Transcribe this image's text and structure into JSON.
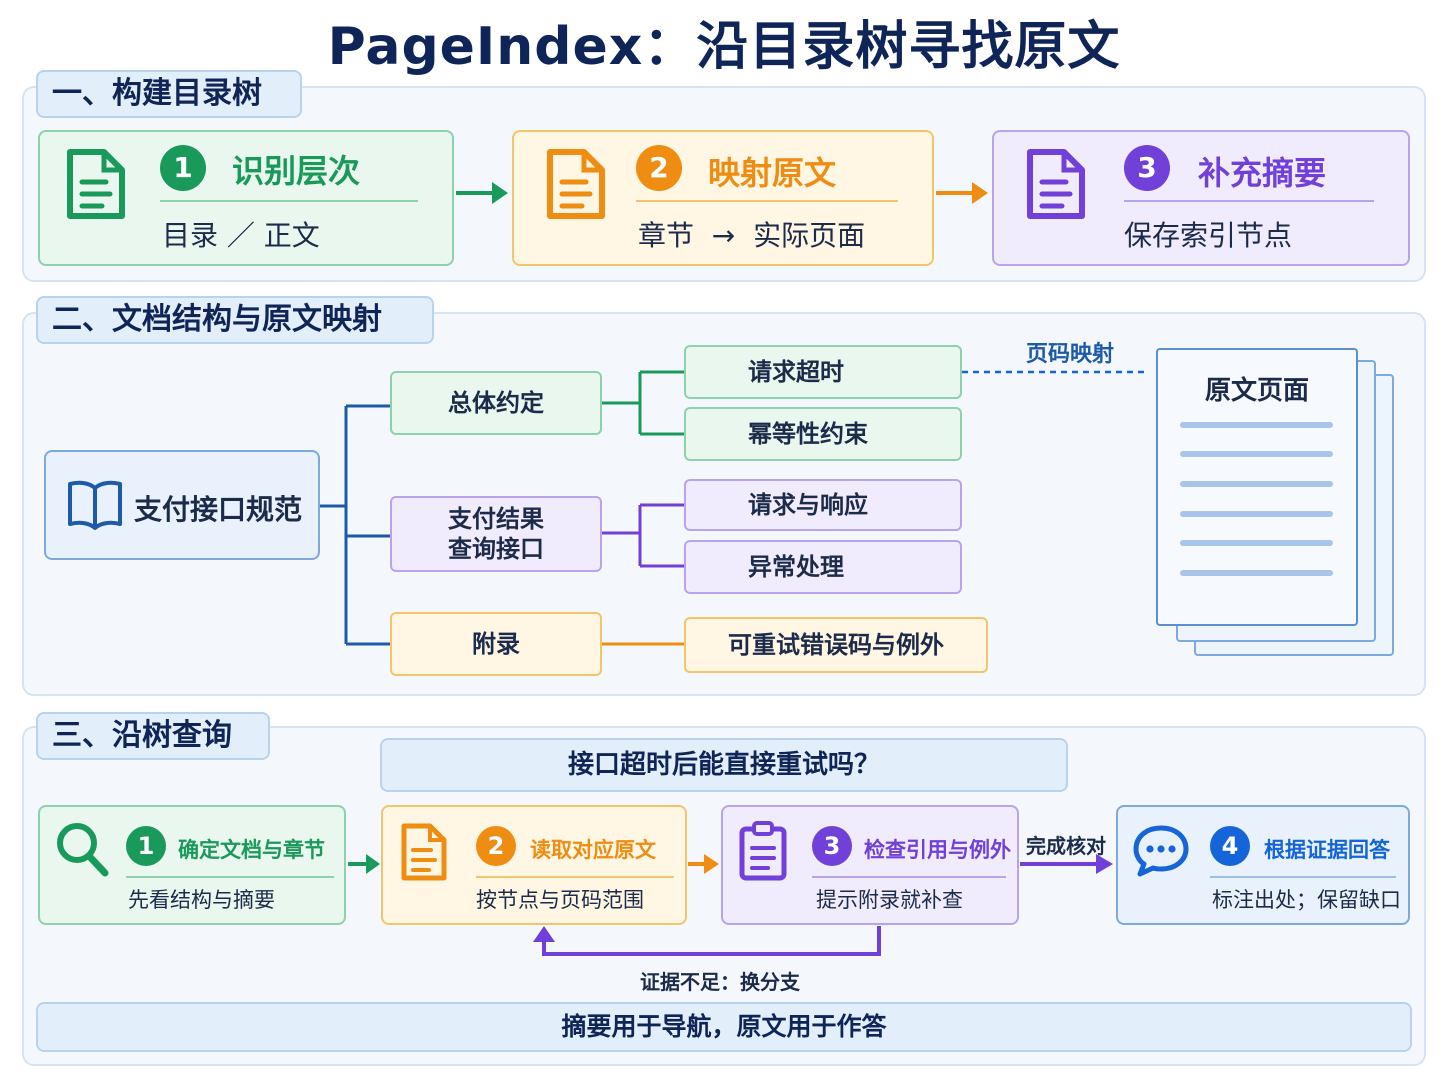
{
  "title": "PageIndex：沿目录树寻找原文",
  "section1": {
    "label": "一、构建目录树",
    "steps": [
      {
        "num": "1",
        "title": "识别层次",
        "subtitle": "目录 ／ 正文",
        "icon": "document-icon"
      },
      {
        "num": "2",
        "title": "映射原文",
        "subtitle": "章节  →  实际页面",
        "icon": "document-icon"
      },
      {
        "num": "3",
        "title": "补充摘要",
        "subtitle": "保存索引节点",
        "icon": "document-icon"
      }
    ]
  },
  "section2": {
    "label": "二、文档结构与原文映射",
    "root": "支付接口规范",
    "branches": [
      {
        "label": "总体约定",
        "children": [
          "请求超时",
          "幂等性约束"
        ]
      },
      {
        "label": "支付结果\n查询接口",
        "children": [
          "请求与响应",
          "异常处理"
        ]
      },
      {
        "label": "附录",
        "children": [
          "可重试错误码与例外"
        ]
      }
    ],
    "mapping_label": "页码映射",
    "page_label": "原文页面"
  },
  "section3": {
    "label": "三、沿树查询",
    "question": "接口超时后能直接重试吗？",
    "steps": [
      {
        "num": "1",
        "title": "确定文档与章节",
        "subtitle": "先看结构与摘要",
        "icon": "search-icon"
      },
      {
        "num": "2",
        "title": "读取对应原文",
        "subtitle": "按节点与页码范围",
        "icon": "document-icon"
      },
      {
        "num": "3",
        "title": "检查引用与例外",
        "subtitle": "提示附录就补查",
        "icon": "clipboard-icon"
      },
      {
        "num": "4",
        "title": "根据证据回答",
        "subtitle": "标注出处；保留缺口",
        "icon": "chat-icon"
      }
    ],
    "done_label": "完成核对",
    "loop_label": "证据不足：换分支",
    "footer": "摘要用于导航，原文用于作答"
  },
  "colors": {
    "green": "#1a9a5a",
    "orange": "#ef8c12",
    "purple": "#7040d8",
    "blue": "#1565d8",
    "navy": "#0f2557"
  }
}
